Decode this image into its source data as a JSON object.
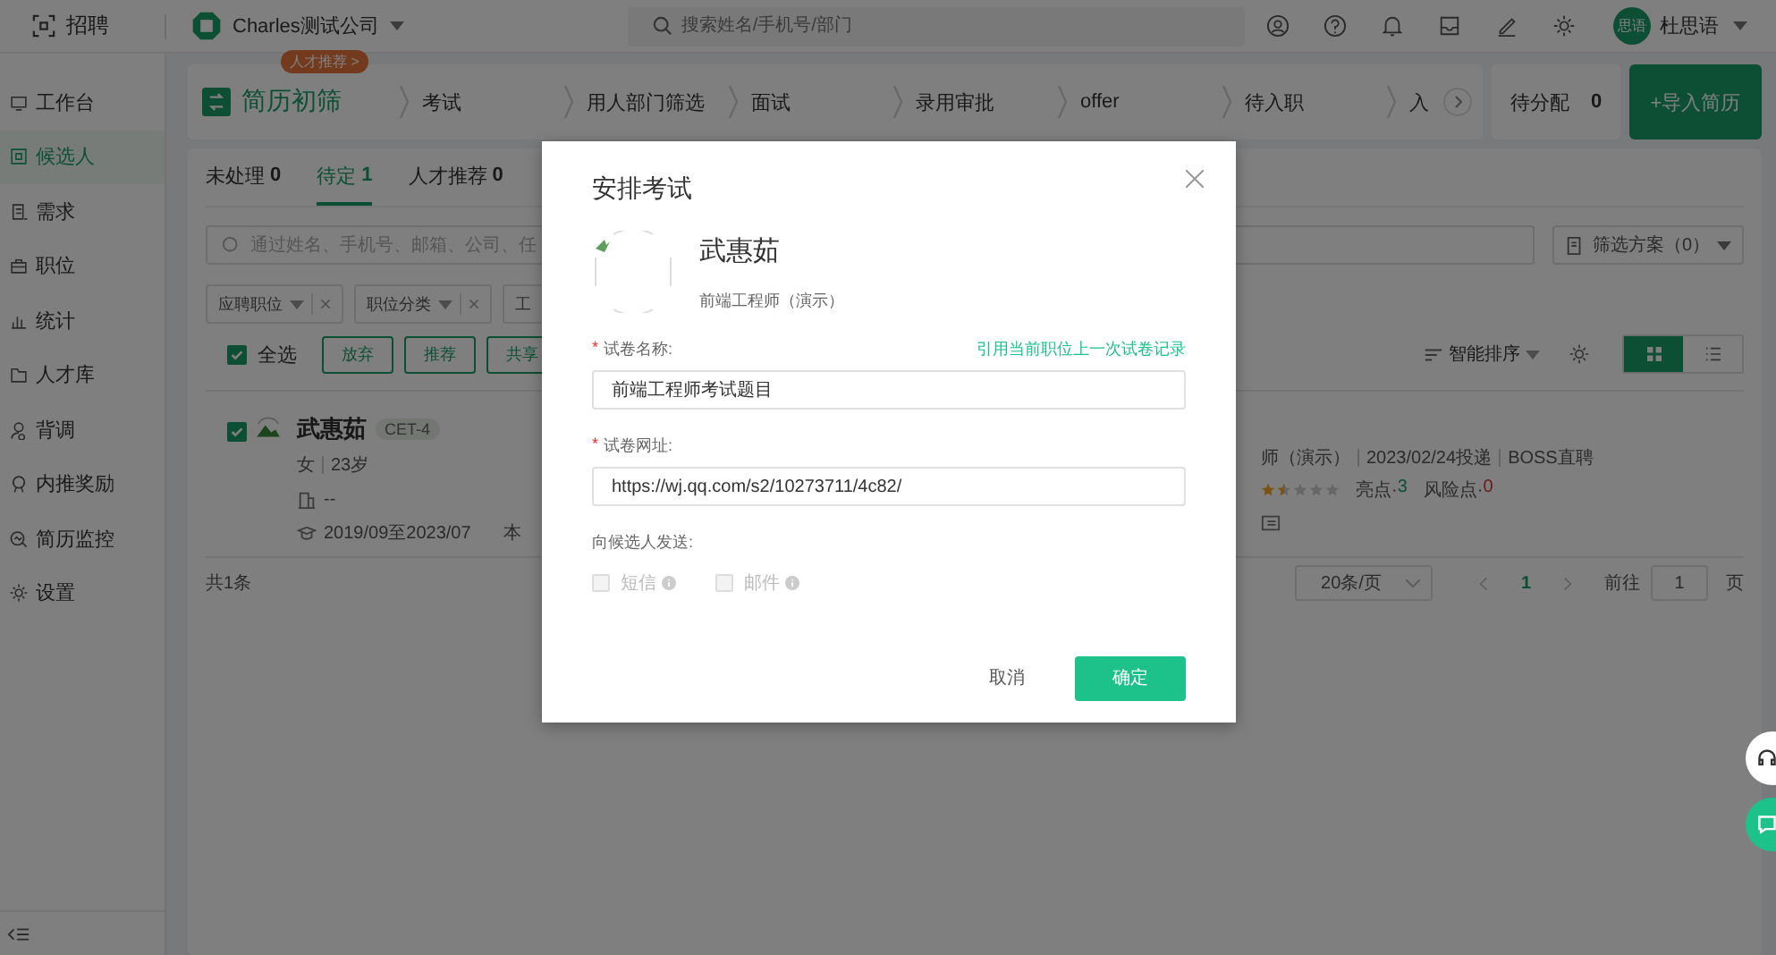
{
  "topbar": {
    "app_name": "招聘",
    "company": "Charles测试公司",
    "search": {
      "placeholder": "搜索姓名/手机号/部门"
    },
    "user": {
      "avatar_text": "思语",
      "name": "杜思语"
    }
  },
  "sidebar": {
    "items": [
      {
        "label": "工作台",
        "selected": false
      },
      {
        "label": "候选人",
        "selected": true
      },
      {
        "label": "需求",
        "selected": false
      },
      {
        "label": "职位",
        "selected": false
      },
      {
        "label": "统计",
        "selected": false
      },
      {
        "label": "人才库",
        "selected": false
      },
      {
        "label": "背调",
        "selected": false
      },
      {
        "label": "内推奖励",
        "selected": false
      },
      {
        "label": "简历监控",
        "selected": false
      },
      {
        "label": "设置",
        "selected": false
      }
    ]
  },
  "stages": [
    {
      "label": "简历初筛",
      "selected": true,
      "badge": "人才推荐 >"
    },
    {
      "label": "考试",
      "selected": false
    },
    {
      "label": "用人部门筛选",
      "selected": false
    },
    {
      "label": "面试",
      "selected": false
    },
    {
      "label": "录用审批",
      "selected": false
    },
    {
      "label": "offer",
      "selected": false
    },
    {
      "label": "待入职",
      "selected": false
    },
    {
      "label": "入",
      "selected": false
    }
  ],
  "pending": {
    "label": "待分配",
    "count": "0"
  },
  "import_button": "+导入简历",
  "tabs": [
    {
      "label": "未处理",
      "count": "0",
      "selected": false
    },
    {
      "label": "待定",
      "count": "1",
      "selected": true
    },
    {
      "label": "人才推荐",
      "count": "0",
      "selected": false
    }
  ],
  "candidate_search": {
    "placeholder": "通过姓名、手机号、邮箱、公司、任"
  },
  "filter_scheme": "筛选方案（0）",
  "filters": [
    "应聘职位",
    "职位分类",
    "工"
  ],
  "select_all": {
    "label": "全选",
    "checked": true
  },
  "actions": [
    "放弃",
    "推荐",
    "共享"
  ],
  "sort": "智能排序",
  "views": [
    {
      "kind": "grid",
      "selected": true
    },
    {
      "kind": "list",
      "selected": false
    }
  ],
  "candidate": {
    "checked": true,
    "name": "武惠茹",
    "tag": "CET-4",
    "gender": "女",
    "age": "23岁",
    "company": "--",
    "education_period": "2019/09至2023/07",
    "degree": "本",
    "position": "师（演示）",
    "applied": "2023/02/24投递",
    "source": "BOSS直聘",
    "stars": 1.5,
    "highlights_label": "亮点·",
    "highlights": "3",
    "risks_label": "风险点·",
    "risks": "0"
  },
  "pagination": {
    "total": "共1条",
    "page_size": "20条/页",
    "current": "1",
    "goto_label": "前往",
    "goto_value": "1",
    "page_unit": "页"
  },
  "dialog": {
    "title": "安排考试",
    "required_mark": "*",
    "name": "武惠茹",
    "position": "前端工程师（演示）",
    "fields": [
      {
        "label": "试卷名称:",
        "required": true,
        "link": "引用当前职位上一次试卷记录",
        "value": "前端工程师考试题目"
      },
      {
        "label": "试卷网址:",
        "required": true,
        "value": "https://wj.qq.com/s2/10273711/4c82/"
      }
    ],
    "send_label": "向候选人发送:",
    "send_options": [
      {
        "label": "短信",
        "checked": false,
        "disabled": true
      },
      {
        "label": "邮件",
        "checked": false,
        "disabled": true
      }
    ],
    "cancel": "取消",
    "confirm": "确定"
  }
}
